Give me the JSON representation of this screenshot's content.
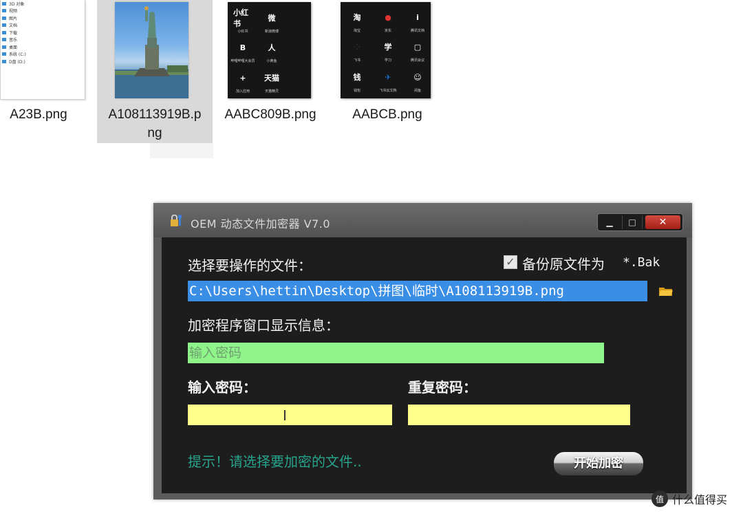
{
  "explorer": {
    "files": [
      {
        "name": "A23B.png"
      },
      {
        "name_line1": "A108113919B.p",
        "name_line2": "ng"
      },
      {
        "name": "AABC809B.png"
      },
      {
        "name": "AABCB.png"
      }
    ],
    "a23_rows": [
      "3D 对象",
      "视频",
      "图片",
      "文档",
      "下载",
      "音乐",
      "桌面",
      "系统 (C:)",
      "D盘 (D:)"
    ],
    "grid1_apps": [
      {
        "label": "小红书",
        "caption": "小红书",
        "color": "#c23b3b"
      },
      {
        "label": "微",
        "caption": "新浪微博",
        "color": "#e8a317"
      },
      {
        "label": "B",
        "caption": "哔哩哔哩大会员",
        "color": "#d8472f"
      },
      {
        "label": "人",
        "caption": "小黄鱼",
        "color": "#3a7dd6"
      },
      {
        "label": "+",
        "caption": "加入应用",
        "color": "#2f7fd8"
      },
      {
        "label": "天猫",
        "caption": "天猫精灵",
        "color": "#1e5fb5"
      }
    ],
    "grid2_apps": [
      {
        "label": "淘",
        "caption": "淘宝",
        "color": "#e33a2b"
      },
      {
        "label": "●",
        "caption": "京东",
        "color": "#e9e9e9"
      },
      {
        "label": "i",
        "caption": "腾讯文档",
        "color": "#2a6fe0"
      },
      {
        "label": "⁘",
        "caption": "飞书",
        "color": "#e9e9e9"
      },
      {
        "label": "学",
        "caption": "学习",
        "color": "#d93b3b"
      },
      {
        "label": "▢",
        "caption": "腾讯会议",
        "color": "#1b6fd0"
      },
      {
        "label": "钱",
        "caption": "钱包",
        "color": "#d93b3b"
      },
      {
        "label": "✈",
        "caption": "飞书云文档",
        "color": "#e9e9e9"
      },
      {
        "label": "☺",
        "caption": "闲鱼",
        "color": "#f0c419"
      }
    ]
  },
  "window": {
    "title": "OEM 动态文件加密器 V7.0",
    "controls": {
      "minimize": "▁",
      "maximize": "□",
      "close": "✕"
    },
    "select_label": "选择要操作的文件：",
    "backup_check": "✓",
    "backup_label": "备份原文件为",
    "backup_ext": "*.Bak",
    "file_path": "C:\\Users\\hettin\\Desktop\\拼图\\临时\\A108113919B.png",
    "info_label": "加密程序窗口显示信息：",
    "info_placeholder": "输入密码",
    "pwd_label": "输入密码：",
    "pwd_repeat_label": "重复密码：",
    "pwd_value": "",
    "pwd_repeat_value": "",
    "hint": "提示！请选择要加密的文件..",
    "start_button": "开始加密"
  },
  "watermark": {
    "icon": "值",
    "text": "什么值得买"
  },
  "colors": {
    "path_bg": "#3a8ee6",
    "info_bg": "#8ff58a",
    "password_bg": "#ffff8c",
    "hint": "#27a38c",
    "close": "#c0392b"
  }
}
